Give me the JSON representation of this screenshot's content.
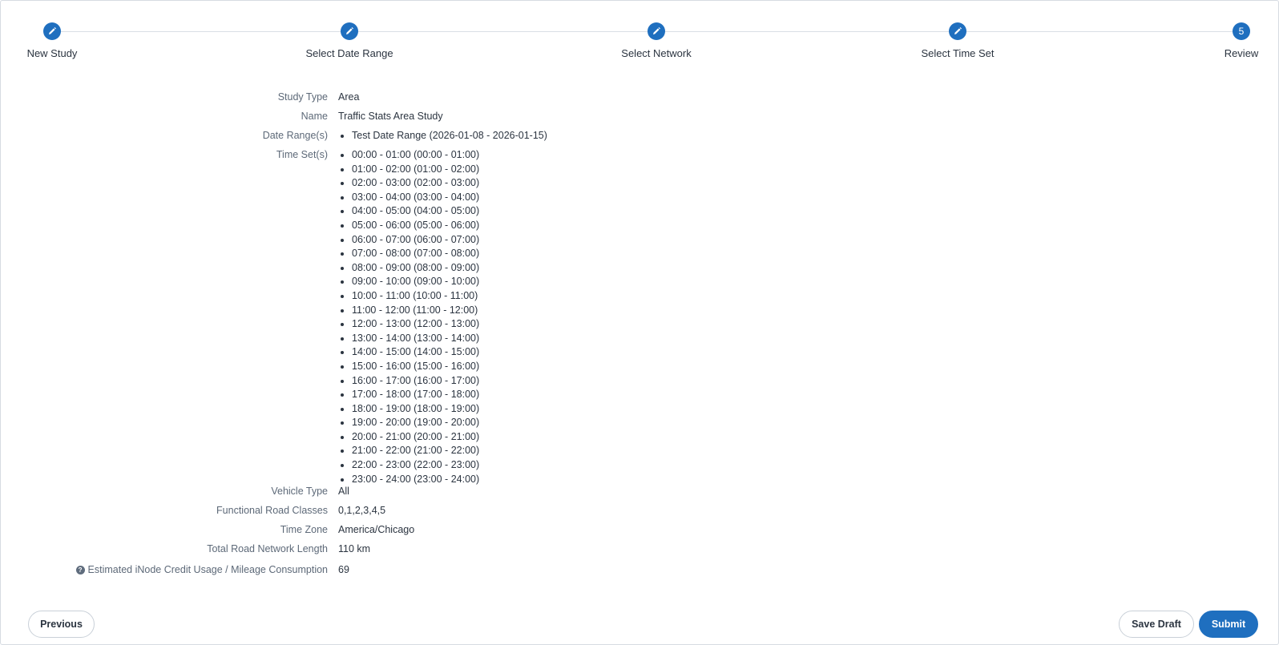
{
  "stepper": {
    "steps": [
      {
        "label": "New Study",
        "status": "completed",
        "icon": "pencil-icon"
      },
      {
        "label": "Select Date Range",
        "status": "completed",
        "icon": "pencil-icon"
      },
      {
        "label": "Select Network",
        "status": "completed",
        "icon": "pencil-icon"
      },
      {
        "label": "Select Time Set",
        "status": "completed",
        "icon": "pencil-icon"
      },
      {
        "label": "Review",
        "status": "current",
        "number": "5"
      }
    ]
  },
  "summary": {
    "study_type": {
      "label": "Study Type",
      "value": "Area"
    },
    "name": {
      "label": "Name",
      "value": "Traffic Stats Area Study"
    },
    "date_ranges": {
      "label": "Date Range(s)",
      "items": [
        "Test Date Range (2026-01-08 - 2026-01-15)"
      ]
    },
    "time_sets": {
      "label": "Time Set(s)",
      "items": [
        "00:00 - 01:00 (00:00 - 01:00)",
        "01:00 - 02:00 (01:00 - 02:00)",
        "02:00 - 03:00 (02:00 - 03:00)",
        "03:00 - 04:00 (03:00 - 04:00)",
        "04:00 - 05:00 (04:00 - 05:00)",
        "05:00 - 06:00 (05:00 - 06:00)",
        "06:00 - 07:00 (06:00 - 07:00)",
        "07:00 - 08:00 (07:00 - 08:00)",
        "08:00 - 09:00 (08:00 - 09:00)",
        "09:00 - 10:00 (09:00 - 10:00)",
        "10:00 - 11:00 (10:00 - 11:00)",
        "11:00 - 12:00 (11:00 - 12:00)",
        "12:00 - 13:00 (12:00 - 13:00)",
        "13:00 - 14:00 (13:00 - 14:00)",
        "14:00 - 15:00 (14:00 - 15:00)",
        "15:00 - 16:00 (15:00 - 16:00)",
        "16:00 - 17:00 (16:00 - 17:00)",
        "17:00 - 18:00 (17:00 - 18:00)",
        "18:00 - 19:00 (18:00 - 19:00)",
        "19:00 - 20:00 (19:00 - 20:00)",
        "20:00 - 21:00 (20:00 - 21:00)",
        "21:00 - 22:00 (21:00 - 22:00)",
        "22:00 - 23:00 (22:00 - 23:00)",
        "23:00 - 24:00 (23:00 - 24:00)"
      ]
    },
    "vehicle_type": {
      "label": "Vehicle Type",
      "value": "All"
    },
    "functional_road_classes": {
      "label": "Functional Road Classes",
      "value": "0,1,2,3,4,5"
    },
    "time_zone": {
      "label": "Time Zone",
      "value": "America/Chicago"
    },
    "total_road_network_length": {
      "label": "Total Road Network Length",
      "value": "110 km"
    },
    "estimated_credit_usage": {
      "label": "Estimated iNode Credit Usage / Mileage Consumption",
      "value": "69",
      "help_glyph": "?"
    }
  },
  "footer": {
    "previous_label": "Previous",
    "save_draft_label": "Save Draft",
    "submit_label": "Submit"
  },
  "colors": {
    "accent": "#1f6fbf",
    "label_text": "#5d6978",
    "value_text": "#2b3440"
  }
}
